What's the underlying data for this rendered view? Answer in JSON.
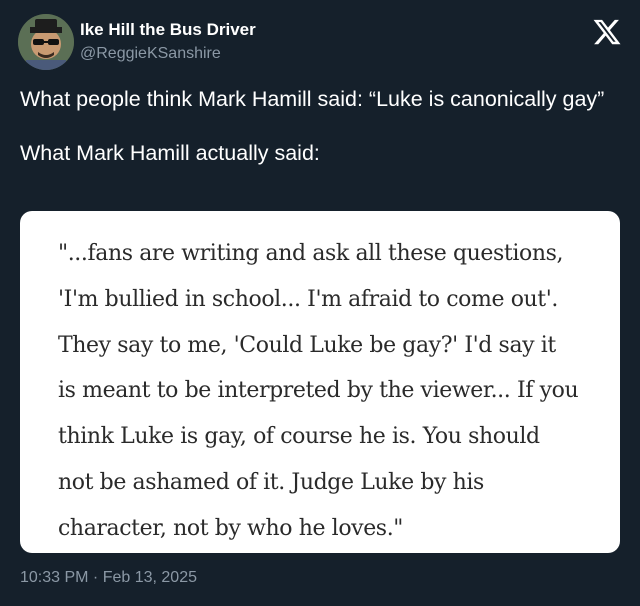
{
  "user": {
    "display_name": "Ike Hill the Bus Driver",
    "handle": "@ReggieKSanshire"
  },
  "brand": {
    "logo_icon": "x-logo-icon",
    "logo_color": "#ffffff"
  },
  "tweet": {
    "line1": "What people think Mark Hamill said: “Luke is canonically gay”",
    "line2": "What Mark Hamill actually said:"
  },
  "quote": {
    "lines": [
      "\"...fans are writing and ask all these questions,",
      "'I'm bullied in school... I'm afraid to come out'.",
      "They say to me, 'Could Luke be gay?' I'd say it",
      "is meant to be interpreted by the viewer... If you",
      "think Luke is gay, of course he is. You should",
      "not be ashamed of it. Judge Luke by his",
      "character, not by who he loves.\""
    ]
  },
  "meta": {
    "timestamp": "10:33 PM · Feb 13, 2025"
  },
  "colors": {
    "background": "#15202b",
    "secondary_text": "#8b98a5",
    "card_background": "#ffffff"
  }
}
